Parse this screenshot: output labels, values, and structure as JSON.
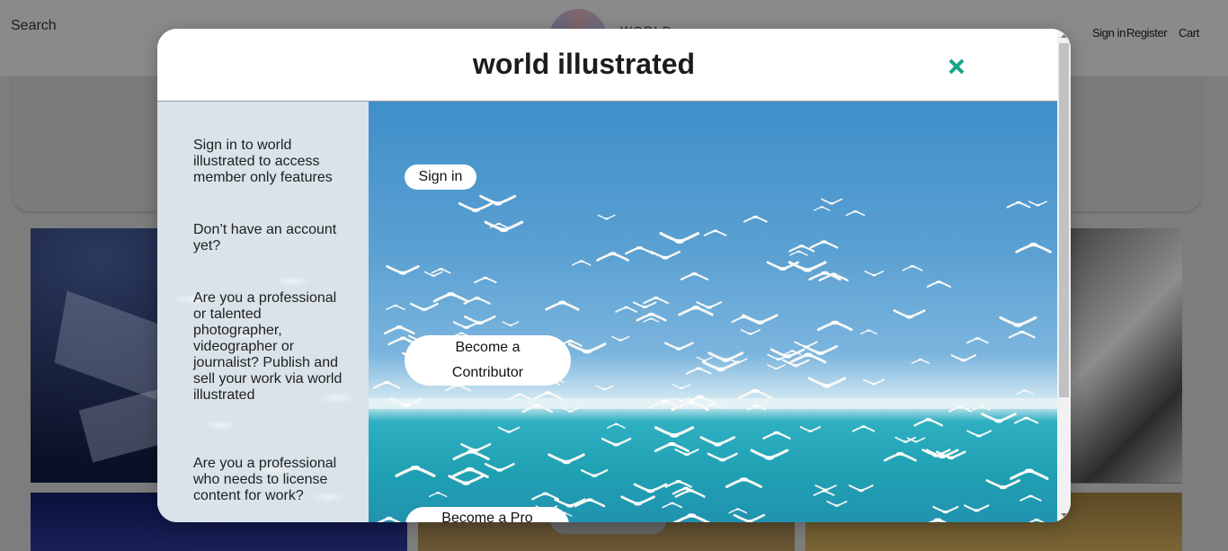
{
  "background": {
    "search_label": "Search",
    "logo_text": "WORLD",
    "nav": {
      "sign_in": "Sign in",
      "register": "Register",
      "cart": "Cart"
    }
  },
  "modal": {
    "title": "world illustrated",
    "close_icon": "close-icon",
    "side": {
      "sign_in_text": "Sign in to world illustrated to access member only features",
      "no_account_text": "Don’t have an account yet?",
      "professional_text": "Are you a professional or talented photographer, videographer or journalist? Publish and sell your work via world illustrated",
      "license_text": "Are you a professional who needs to license content for work?"
    },
    "buttons": {
      "sign_in": "Sign in",
      "contributor_line1": "Become a",
      "contributor_line2": "Contributor",
      "pro": "Become a Pro"
    },
    "colors": {
      "close_accent": "#14a58a",
      "side_bg": "#d9e3e9"
    }
  }
}
